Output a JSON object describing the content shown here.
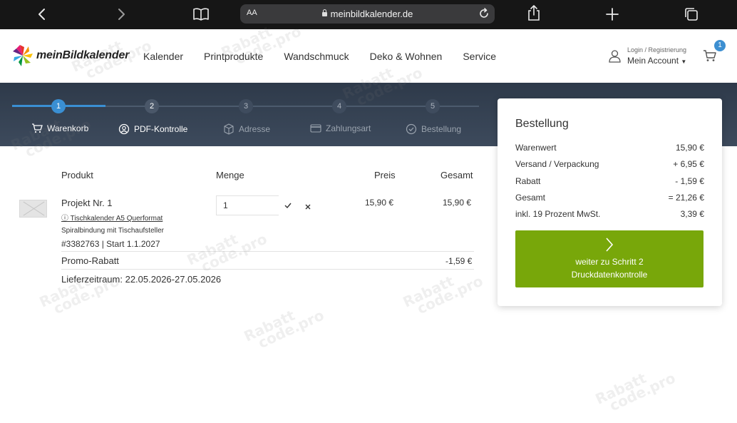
{
  "browser": {
    "text_size_label": "AA",
    "url": "meinbildkalender.de"
  },
  "site": {
    "logo_text": "meinBildkalender",
    "nav": [
      "Kalender",
      "Printprodukte",
      "Wandschmuck",
      "Deko & Wohnen",
      "Service"
    ],
    "account": {
      "small": "Login / Registrierung",
      "label": "Mein Account"
    },
    "cart_count": "1"
  },
  "steps": [
    {
      "num": "1",
      "label": "Warenkorb",
      "state": "active"
    },
    {
      "num": "2",
      "label": "PDF-Kontrolle",
      "state": "next"
    },
    {
      "num": "3",
      "label": "Adresse",
      "state": "inactive"
    },
    {
      "num": "4",
      "label": "Zahlungsart",
      "state": "inactive"
    },
    {
      "num": "5",
      "label": "Bestellung",
      "state": "inactive"
    }
  ],
  "table": {
    "headers": {
      "product": "Produkt",
      "qty": "Menge",
      "price": "Preis",
      "total": "Gesamt"
    },
    "item": {
      "name": "Projekt Nr. 1",
      "info_icon": "ⓘ",
      "format_link": "Tischkalender A5 Querformat",
      "binding": "Spiralbindung mit Tischaufsteller",
      "id_start": "#3382763 | Start 1.1.2027",
      "qty": "1",
      "price": "15,90 €",
      "total": "15,90 €"
    },
    "promo": {
      "label": "Promo-Rabatt",
      "value": "-1,59 €"
    },
    "delivery": "Lieferzeitraum: 22.05.2026-27.05.2026"
  },
  "summary": {
    "title": "Bestellung",
    "rows": [
      {
        "label": "Warenwert",
        "value": "15,90 €"
      },
      {
        "label": "Versand / Verpackung",
        "value": "+ 6,95 €"
      },
      {
        "label": "Rabatt",
        "value": "- 1,59 €"
      },
      {
        "label": "Gesamt",
        "value": "= 21,26 €"
      },
      {
        "label": "inkl. 19 Prozent MwSt.",
        "value": "3,39 €"
      }
    ],
    "cta_line1": "weiter zu Schritt 2",
    "cta_line2": "Druckdatenkontrolle"
  },
  "watermark": {
    "line1": "Rabatt",
    "line2": "code.pro"
  },
  "colors": {
    "accent_blue": "#3a8fd3",
    "cta_green": "#78a70a",
    "band_dark": "#2e3a4a"
  }
}
